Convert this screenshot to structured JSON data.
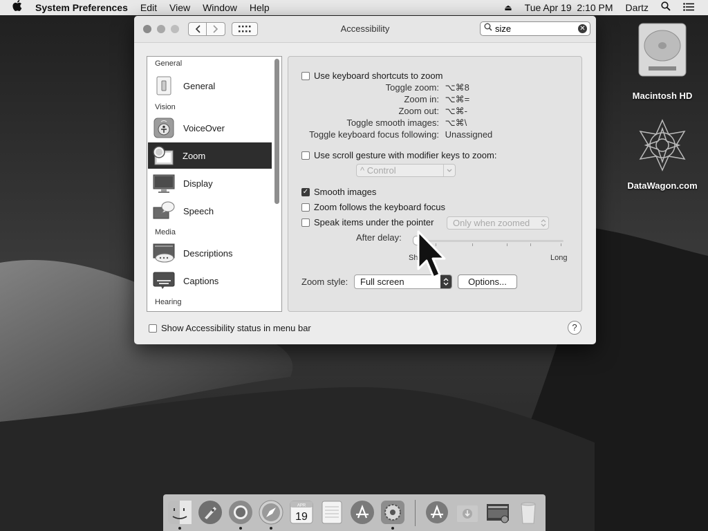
{
  "menubar": {
    "app_name": "System Preferences",
    "menus": [
      "Edit",
      "View",
      "Window",
      "Help"
    ],
    "datetime": "Tue Apr 19  2:10 PM",
    "user": "Dartz"
  },
  "desktop": {
    "icons": [
      {
        "label": "Macintosh HD"
      },
      {
        "label": "DataWagon.com"
      }
    ]
  },
  "window": {
    "title": "Accessibility",
    "search": {
      "value": "size"
    }
  },
  "sidebar": {
    "sections": {
      "general": "General",
      "vision": "Vision",
      "media": "Media",
      "hearing": "Hearing"
    },
    "items": [
      {
        "label": "General",
        "icon": "switch-icon"
      },
      {
        "label": "VoiceOver",
        "icon": "voiceover-icon"
      },
      {
        "label": "Zoom",
        "icon": "zoom-icon",
        "selected": true
      },
      {
        "label": "Display",
        "icon": "display-icon"
      },
      {
        "label": "Speech",
        "icon": "speech-icon"
      },
      {
        "label": "Descriptions",
        "icon": "descriptions-icon"
      },
      {
        "label": "Captions",
        "icon": "captions-icon"
      }
    ]
  },
  "zoom": {
    "keyboard_shortcuts": {
      "label": "Use keyboard shortcuts to zoom",
      "checked": false
    },
    "shortcuts": [
      {
        "key": "Toggle zoom:",
        "value": "⌥⌘8"
      },
      {
        "key": "Zoom in:",
        "value": "⌥⌘="
      },
      {
        "key": "Zoom out:",
        "value": "⌥⌘-"
      },
      {
        "key": "Toggle smooth images:",
        "value": "⌥⌘\\"
      },
      {
        "key": "Toggle keyboard focus following:",
        "value": "Unassigned"
      }
    ],
    "scroll_gesture": {
      "label": "Use scroll gesture with modifier keys to zoom:",
      "checked": false
    },
    "modifier_key": {
      "value": "^ Control"
    },
    "smooth_images": {
      "label": "Smooth images",
      "checked": true
    },
    "follow_focus": {
      "label": "Zoom follows the keyboard focus",
      "checked": false
    },
    "speak_items": {
      "label": "Speak items under the pointer",
      "checked": false,
      "option": "Only when zoomed"
    },
    "after_delay": {
      "label": "After delay:",
      "min_label": "Short",
      "max_label": "Long",
      "value": 0
    },
    "zoom_style": {
      "label": "Zoom style:",
      "value": "Full screen"
    },
    "options_button": "Options..."
  },
  "footer": {
    "status_menu": {
      "label": "Show Accessibility status in menu bar",
      "checked": false
    },
    "help": "?"
  },
  "dock": {
    "date_month": "APR",
    "date_day": "19"
  }
}
